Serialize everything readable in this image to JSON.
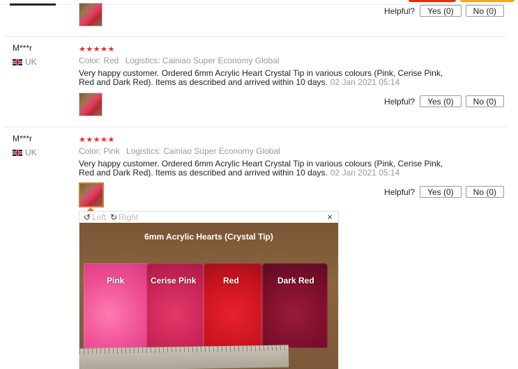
{
  "helpful_label": "Helpful?",
  "yes_label": "Yes (0)",
  "no_label": "No (0)",
  "reviews": [
    {
      "user": "M***r",
      "country": "UK",
      "stars": "★★★★★",
      "color": "Color: Red",
      "logistics": "Logistics: Cainiao Super Economy Global",
      "text": "Very happy customer. Ordered 6mm Acrylic Heart Crystal Tip in various colours (Pink, Cerise Pink, Red and Dark Red). Items as described and arrived within 10 days.",
      "date": "02 Jan 2021 05:14"
    },
    {
      "user": "M***r",
      "country": "UK",
      "stars": "★★★★★",
      "color": "Color: Pink",
      "logistics": "Logistics: Cainiao Super Economy Global",
      "text": "Very happy customer. Ordered 6mm Acrylic Heart Crystal Tip in various colours (Pink, Cerise Pink, Red and Dark Red). Items as described and arrived within 10 days.",
      "date": "02 Jan 2021 05:14"
    }
  ],
  "viewer": {
    "rotate_left": "Left",
    "rotate_right": "Right",
    "close": "×",
    "photo_title": "6mm Acrylic Hearts (Crystal Tip)",
    "bag_labels": [
      "Pink",
      "Cerise Pink",
      "Red",
      "Dark Red"
    ]
  },
  "colors": {
    "star": "#f5222d",
    "accent": "#ff6a00"
  }
}
